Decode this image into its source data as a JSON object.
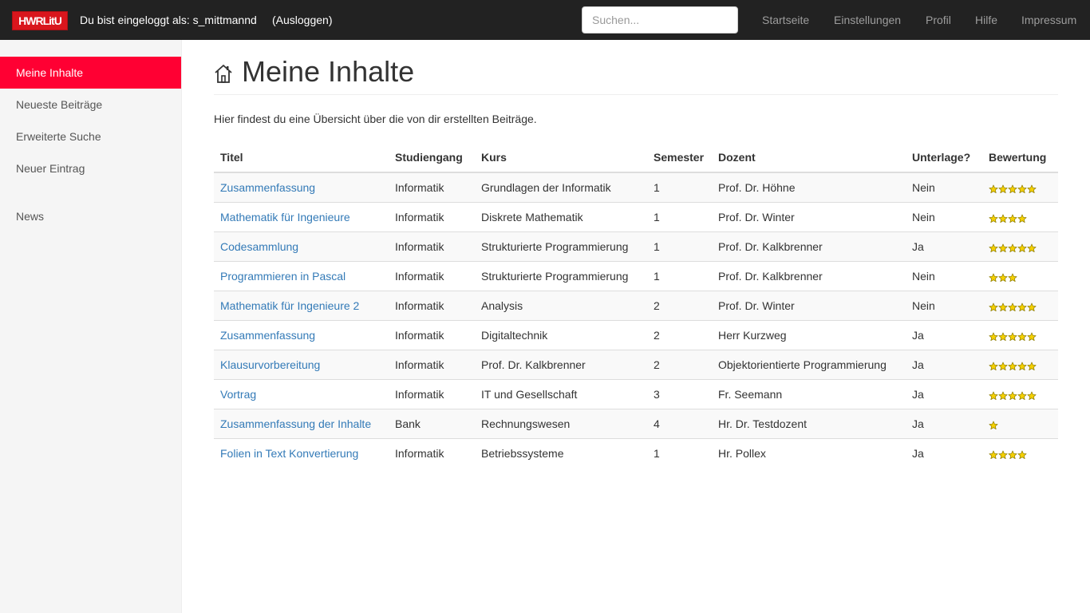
{
  "navbar": {
    "brand": "HWRLitU",
    "login_text": "Du bist eingeloggt als: s_mittmannd",
    "logout": "(Ausloggen)",
    "search_placeholder": "Suchen...",
    "links": [
      "Startseite",
      "Einstellungen",
      "Profil",
      "Hilfe",
      "Impressum"
    ]
  },
  "sidebar": {
    "items": [
      {
        "label": "Meine Inhalte",
        "active": true
      },
      {
        "label": "Neueste Beiträge",
        "active": false
      },
      {
        "label": "Erweiterte Suche",
        "active": false
      },
      {
        "label": "Neuer Eintrag",
        "active": false
      },
      {
        "label": "News",
        "active": false
      }
    ]
  },
  "main": {
    "title": "Meine Inhalte",
    "intro": "Hier findest du eine Übersicht über die von dir erstellten Beiträge.",
    "table": {
      "headers": [
        "Titel",
        "Studiengang",
        "Kurs",
        "Semester",
        "Dozent",
        "Unterlage?",
        "Bewertung"
      ],
      "rows": [
        {
          "titel": "Zusammenfassung",
          "studiengang": "Informatik",
          "kurs": "Grundlagen der Informatik",
          "semester": "1",
          "dozent": "Prof. Dr. Höhne",
          "unterlage": "Nein",
          "bewertung": 5
        },
        {
          "titel": "Mathematik für Ingenieure",
          "studiengang": "Informatik",
          "kurs": "Diskrete Mathematik",
          "semester": "1",
          "dozent": "Prof. Dr. Winter",
          "unterlage": "Nein",
          "bewertung": 4
        },
        {
          "titel": "Codesammlung",
          "studiengang": "Informatik",
          "kurs": "Strukturierte Programmierung",
          "semester": "1",
          "dozent": "Prof. Dr. Kalkbrenner",
          "unterlage": "Ja",
          "bewertung": 5
        },
        {
          "titel": "Programmieren in Pascal",
          "studiengang": "Informatik",
          "kurs": "Strukturierte Programmierung",
          "semester": "1",
          "dozent": "Prof. Dr. Kalkbrenner",
          "unterlage": "Nein",
          "bewertung": 3
        },
        {
          "titel": "Mathematik für Ingenieure 2",
          "studiengang": "Informatik",
          "kurs": "Analysis",
          "semester": "2",
          "dozent": "Prof. Dr. Winter",
          "unterlage": "Nein",
          "bewertung": 5
        },
        {
          "titel": "Zusammenfassung",
          "studiengang": "Informatik",
          "kurs": "Digitaltechnik",
          "semester": "2",
          "dozent": "Herr Kurzweg",
          "unterlage": "Ja",
          "bewertung": 5
        },
        {
          "titel": "Klausurvorbereitung",
          "studiengang": "Informatik",
          "kurs": "Prof. Dr. Kalkbrenner",
          "semester": "2",
          "dozent": "Objektorientierte Programmierung",
          "unterlage": "Ja",
          "bewertung": 5
        },
        {
          "titel": "Vortrag",
          "studiengang": "Informatik",
          "kurs": "IT und Gesellschaft",
          "semester": "3",
          "dozent": "Fr. Seemann",
          "unterlage": "Ja",
          "bewertung": 5
        },
        {
          "titel": "Zusammenfassung der Inhalte",
          "studiengang": "Bank",
          "kurs": "Rechnungswesen",
          "semester": "4",
          "dozent": "Hr. Dr. Testdozent",
          "unterlage": "Ja",
          "bewertung": 1
        },
        {
          "titel": "Folien in Text Konvertierung",
          "studiengang": "Informatik",
          "kurs": "Betriebssysteme",
          "semester": "1",
          "dozent": "Hr. Pollex",
          "unterlage": "Ja",
          "bewertung": 4
        }
      ]
    }
  },
  "colors": {
    "navbar_bg": "#222222",
    "accent_active": "#ff0033",
    "link": "#337ab7",
    "star": "#f5d000"
  }
}
